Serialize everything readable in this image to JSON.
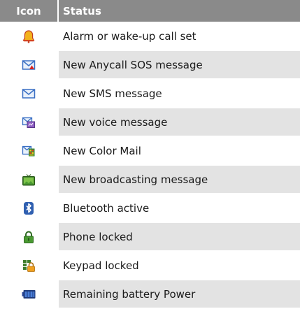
{
  "table": {
    "header": {
      "icon": "Icon",
      "status": "Status"
    },
    "rows": [
      {
        "icon": "alarm-bell-icon",
        "status": "Alarm or wake-up call set"
      },
      {
        "icon": "anycall-sos-envelope-icon",
        "status": "New Anycall SOS message"
      },
      {
        "icon": "sms-envelope-icon",
        "status": "New SMS message"
      },
      {
        "icon": "voice-message-envelope-icon",
        "status": "New voice message"
      },
      {
        "icon": "color-mail-envelope-icon",
        "status": "New Color Mail"
      },
      {
        "icon": "broadcast-tv-icon",
        "status": "New broadcasting message"
      },
      {
        "icon": "bluetooth-icon",
        "status": "Bluetooth active"
      },
      {
        "icon": "padlock-icon",
        "status": "Phone locked"
      },
      {
        "icon": "keypad-lock-icon",
        "status": "Keypad locked"
      },
      {
        "icon": "battery-icon",
        "status": "Remaining battery Power"
      }
    ]
  },
  "colors": {
    "header_bg": "#8a8a8a",
    "shaded_row_bg": "#e3e3e3",
    "icon_blue": "#3a6fc4",
    "icon_orange": "#e8a21a",
    "icon_green": "#4a9a32"
  }
}
